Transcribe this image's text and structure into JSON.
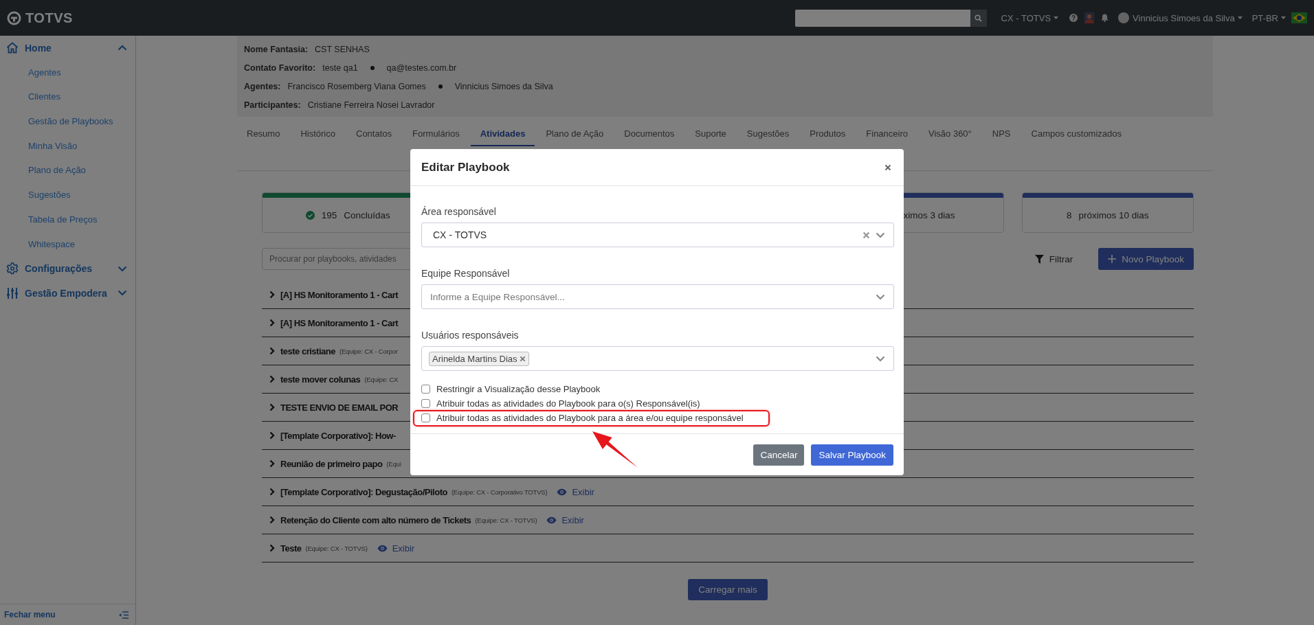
{
  "topbar": {
    "logo": "TOTVS",
    "company": "CX - TOTVS",
    "user": "Vinnicius Simoes da Silva",
    "language": "PT-BR"
  },
  "sidebar": {
    "items": [
      {
        "label": "Home",
        "kind": "home",
        "expanded": true,
        "children": [
          {
            "label": "Agentes"
          },
          {
            "label": "Clientes"
          },
          {
            "label": "Gestão de Playbooks"
          },
          {
            "label": "Minha Visão"
          },
          {
            "label": "Plano de Ação"
          },
          {
            "label": "Sugestões"
          },
          {
            "label": "Tabela de Preços"
          },
          {
            "label": "Whitespace"
          }
        ]
      },
      {
        "label": "Configurações",
        "kind": "gear",
        "expanded": false
      },
      {
        "label": "Gestão Empodera",
        "kind": "sliders",
        "expanded": false
      }
    ],
    "footer": "Fechar menu"
  },
  "client_info": [
    {
      "label": "Nome Fantasia:",
      "values": [
        "CST SENHAS"
      ]
    },
    {
      "label": "Contato Favorito:",
      "values": [
        "teste qa1",
        "qa@testes.com.br"
      ]
    },
    {
      "label": "Agentes:",
      "values": [
        "Francisco Rosemberg Viana Gomes",
        "Vinnicius Simoes da Silva"
      ]
    },
    {
      "label": "Participantes:",
      "values": [
        "Cristiane Ferreira Nosei Lavrador"
      ]
    }
  ],
  "tabs": [
    {
      "label": "Resumo",
      "selected": false
    },
    {
      "label": "Histórico",
      "selected": false
    },
    {
      "label": "Contatos",
      "selected": false
    },
    {
      "label": "Formulários",
      "selected": false
    },
    {
      "label": "Atividades",
      "selected": true
    },
    {
      "label": "Plano de Ação",
      "selected": false
    },
    {
      "label": "Documentos",
      "selected": false
    },
    {
      "label": "Suporte",
      "selected": false
    },
    {
      "label": "Sugestões",
      "selected": false
    },
    {
      "label": "Produtos",
      "selected": false
    },
    {
      "label": "Financeiro",
      "selected": false
    },
    {
      "label": "Visão 360°",
      "selected": false
    },
    {
      "label": "NPS",
      "selected": false
    },
    {
      "label": "Campos customizados",
      "selected": false
    }
  ],
  "summary_cards": [
    {
      "count": "195",
      "label": "Concluídas",
      "color": "#0f4a30",
      "kind": "done"
    },
    {
      "label": "ximos 3 dias",
      "color": "#202e5c",
      "kind": "partial"
    },
    {
      "count": "8",
      "label": "próximos 10 dias",
      "color": "#202e5c",
      "kind": "plain"
    }
  ],
  "search": {
    "placeholder": "Procurar por playbooks, atividades"
  },
  "filter": "Filtrar",
  "new_button": "Novo Playbook",
  "playbooks": [
    {
      "title": "[A] HS Monitoramento 1 - Cart"
    },
    {
      "title": "[A] HS Monitoramento 1 - Cart"
    },
    {
      "title": "teste cristiane",
      "team": "(Equipe: CX - Corpor"
    },
    {
      "title": "teste mover colunas",
      "team": "(Equipe: CX"
    },
    {
      "title": "TESTE ENVIO DE EMAIL POR"
    },
    {
      "title": "[Template Corporativo]: How-"
    },
    {
      "title": "Reunião de primeiro papo",
      "team": "(Equi"
    },
    {
      "title": "[Template Corporativo]: Degustação/Piloto",
      "team": "(Equipe: CX - Corporativo TOTVS)",
      "action": "Exibir"
    },
    {
      "title": "Retenção do Cliente com alto número de Tickets",
      "team": "(Equipe: CX - TOTVS)",
      "action": "Exibir"
    },
    {
      "title": "Teste",
      "team": "(Equipe: CX - TOTVS)",
      "action": "Exibir"
    }
  ],
  "load_more": "Carregar mais",
  "modal": {
    "title": "Editar Playbook",
    "fields": [
      {
        "label": "Área responsável",
        "kind": "select",
        "value": "CX - TOTVS"
      },
      {
        "label": "Equipe Responsável",
        "kind": "select",
        "placeholder": "Informe a Equipe Responsável..."
      },
      {
        "label": "Usuários responsáveis",
        "kind": "tags",
        "tags": [
          "Arinelda Martins Dias"
        ]
      }
    ],
    "options": [
      {
        "label": "Restringir a Visualização desse Playbook",
        "checked": false,
        "highlighted": false
      },
      {
        "label": "Atribuir todas as atividades do Playbook para o(s) Responsável(is)",
        "checked": false,
        "highlighted": false
      },
      {
        "label": "Atribuir todas as atividades do Playbook para a área e/ou equipe responsável",
        "checked": false,
        "highlighted": true
      }
    ],
    "buttons": [
      {
        "label": "Cancelar",
        "kind": "secondary"
      },
      {
        "label": "Salvar Playbook",
        "kind": "primary"
      }
    ]
  }
}
